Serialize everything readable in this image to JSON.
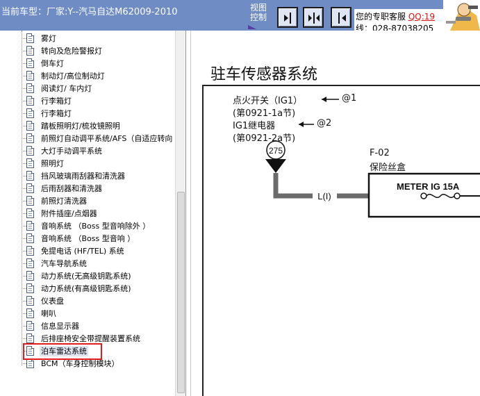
{
  "header": {
    "model_label": "当前车型：厂家:Y--汽马自达M62009-2010",
    "view_control_line1": "视图",
    "view_control_line2": "控制",
    "service_prefix": "您的专职客服",
    "service_qq": "QQ:19",
    "service_line2": "线：028-87038205"
  },
  "tree": {
    "items": [
      {
        "label": "雾灯"
      },
      {
        "label": "转向及危险警报灯"
      },
      {
        "label": "倒车灯"
      },
      {
        "label": "制动灯/高位制动灯"
      },
      {
        "label": "阅读灯/ 车内灯"
      },
      {
        "label": "行李箱灯"
      },
      {
        "label": "行李箱灯"
      },
      {
        "label": "踏板照明灯/梳妆镜照明"
      },
      {
        "label": "前照灯自动调平系统/AFS（自适应转向"
      },
      {
        "label": "大灯手动调平系统"
      },
      {
        "label": "照明灯"
      },
      {
        "label": "挡风玻璃雨刮器和清洗器"
      },
      {
        "label": "后雨刮器和清洗器"
      },
      {
        "label": "前照灯清洗器"
      },
      {
        "label": "附件插座/点烟器"
      },
      {
        "label": "音响系统  （Boss 型音响除外 ）"
      },
      {
        "label": "音响系统  （Boss 型音响 ）"
      },
      {
        "label": "免提电话 (HF/TEL) 系统"
      },
      {
        "label": "汽车导航系统"
      },
      {
        "label": "动力系统(无高级钥匙系统)"
      },
      {
        "label": "动力系统(有高级钥匙系统)"
      },
      {
        "label": "仪表盘"
      },
      {
        "label": "喇叭"
      },
      {
        "label": "信息显示器"
      },
      {
        "label": "后排座椅安全带提醒装置系统"
      },
      {
        "label": "泊车雷达系统"
      },
      {
        "label": "BCM（车身控制模块）"
      }
    ],
    "selected_label": "泊车雷达系统"
  },
  "diagram": {
    "title": "驻车传感器系统",
    "note1_line1": "点火开关（IG1）",
    "note1_ref": "@1",
    "note1_line2": "(第0921-1a节)",
    "note2_line1": "IG1继电器",
    "note2_ref": "@2",
    "note2_line2": "(第0921-2a节)",
    "connector_number": "275",
    "wire_label": "L(I)",
    "fuse_box_id": "F-02",
    "fuse_box_name": "保险丝盒",
    "fuse_name": "METER IG 15A"
  },
  "colors": {
    "header_bg": "#6f8cc4",
    "selection_box": "#e21b1b",
    "qq_text": "#e01010",
    "wire": "#6b6b6b"
  },
  "icons": {
    "tree_item": "document-icon",
    "btn_expand_right": "expand-right-icon",
    "btn_collapse": "collapse-icon",
    "btn_expand_left": "expand-left-icon",
    "mascot": "mascot-icon"
  }
}
